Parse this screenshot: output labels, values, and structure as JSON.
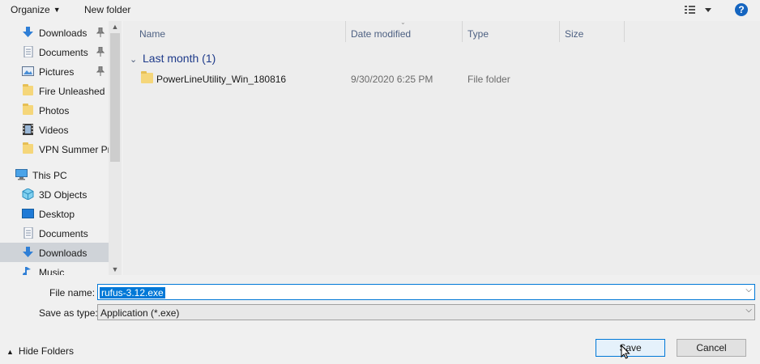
{
  "toolbar": {
    "organize_label": "Organize",
    "new_folder_label": "New folder",
    "help_label": "?"
  },
  "nav": {
    "quick_access": [
      {
        "label": "Downloads",
        "icon": "download-arrow-icon",
        "pinned": true
      },
      {
        "label": "Documents",
        "icon": "document-icon",
        "pinned": true
      },
      {
        "label": "Pictures",
        "icon": "pictures-icon",
        "pinned": true
      },
      {
        "label": "Fire Unleashed",
        "icon": "folder-icon",
        "pinned": false
      },
      {
        "label": "Photos",
        "icon": "folder-icon",
        "pinned": false
      },
      {
        "label": "Videos",
        "icon": "videos-icon",
        "pinned": false
      },
      {
        "label": "VPN Summer Pr",
        "icon": "folder-icon",
        "pinned": false
      }
    ],
    "this_pc_label": "This PC",
    "this_pc_items": [
      {
        "label": "3D Objects",
        "icon": "3d-objects-icon"
      },
      {
        "label": "Desktop",
        "icon": "desktop-icon"
      },
      {
        "label": "Documents",
        "icon": "document-icon"
      },
      {
        "label": "Downloads",
        "icon": "download-arrow-icon",
        "selected": true
      },
      {
        "label": "Music",
        "icon": "music-icon"
      }
    ]
  },
  "columns": {
    "name": "Name",
    "date_modified": "Date modified",
    "type": "Type",
    "size": "Size"
  },
  "group": {
    "label": "Last month (1)"
  },
  "files": [
    {
      "name": "PowerLineUtility_Win_180816",
      "date_modified": "9/30/2020 6:25 PM",
      "type": "File folder",
      "size": ""
    }
  ],
  "form": {
    "file_name_label": "File name:",
    "file_name_value": "rufus-3.12.exe",
    "save_as_type_label": "Save as type:",
    "save_as_type_value": "Application (*.exe)"
  },
  "footer": {
    "hide_folders_label": "Hide Folders",
    "save_label": "Save",
    "cancel_label": "Cancel"
  },
  "colors": {
    "accent": "#0078d7",
    "selected_nav": "#cfd3d8",
    "header_text": "#4d6082",
    "group_text": "#1e3a8a"
  }
}
